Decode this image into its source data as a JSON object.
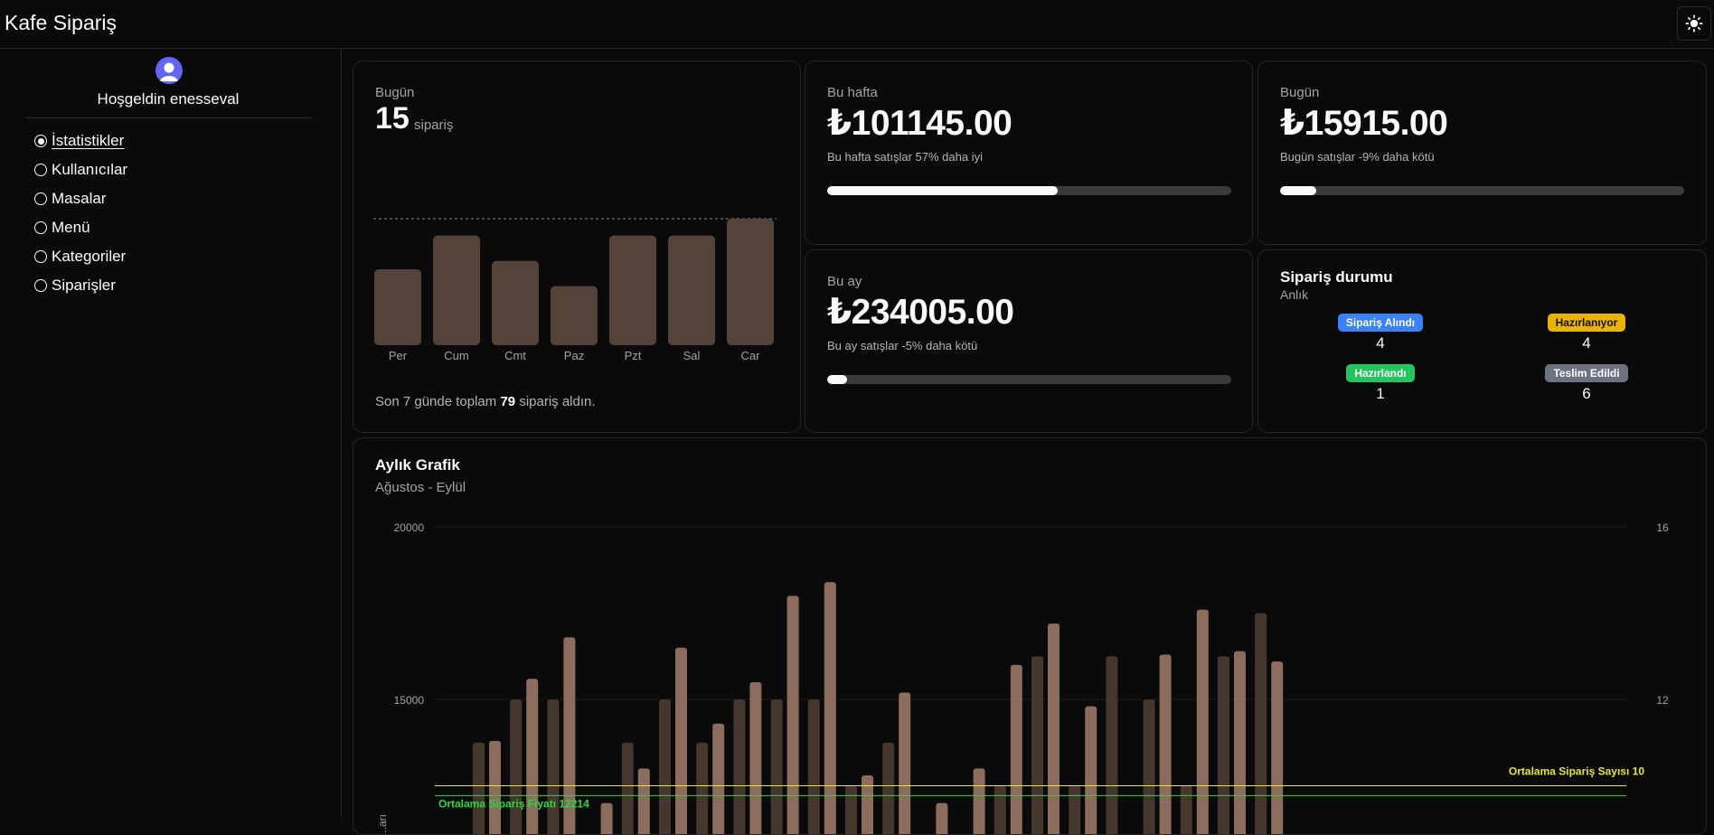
{
  "app": {
    "title": "Kafe Sipariş"
  },
  "theme_toggle": {
    "icon": "sun-icon"
  },
  "sidebar": {
    "welcome": "Hoşgeldin enesseval",
    "items": [
      {
        "label": "İstatistikler",
        "active": true
      },
      {
        "label": "Kullanıcılar",
        "active": false
      },
      {
        "label": "Masalar",
        "active": false
      },
      {
        "label": "Menü",
        "active": false
      },
      {
        "label": "Kategoriler",
        "active": false
      },
      {
        "label": "Siparişler",
        "active": false
      }
    ]
  },
  "today_orders": {
    "label": "Bugün",
    "count": "15",
    "unit": "sipariş",
    "summary_prefix": "Son 7 günde toplam",
    "summary_total": "79",
    "summary_suffix": "sipariş aldın."
  },
  "weekly": {
    "label": "Bu hafta",
    "amount": "₺101145.00",
    "sub": "Bu hafta satışlar 57% daha iyi",
    "progress": 0.57
  },
  "today_sales": {
    "label": "Bugün",
    "amount": "₺15915.00",
    "sub": "Bugün satışlar -9% daha kötü",
    "progress": 0.09
  },
  "monthly_sales": {
    "label": "Bu ay",
    "amount": "₺234005.00",
    "sub": "Bu ay satışlar -5% daha kötü",
    "progress": 0.05
  },
  "order_status": {
    "title": "Sipariş durumu",
    "subtitle": "Anlık",
    "items": [
      {
        "label": "Sipariş Alındı",
        "count": "4",
        "color": "#3b82f6"
      },
      {
        "label": "Hazırlanıyor",
        "count": "4",
        "color": "#eab308"
      },
      {
        "label": "Hazırlandı",
        "count": "1",
        "color": "#22c55e"
      },
      {
        "label": "Teslim Edildi",
        "count": "6",
        "color": "#6b7280"
      }
    ]
  },
  "colors": {
    "bar_brown": "#544338",
    "bar_dark": "#45362e",
    "bar_light": "#8c6c5c",
    "avg_count_line": "#e5e53a",
    "avg_price_line": "#2bd93f"
  },
  "chart_data": [
    {
      "type": "bar",
      "categories": [
        "Per",
        "Cum",
        "Cmt",
        "Paz",
        "Pzt",
        "Sal",
        "Çar"
      ],
      "values": [
        9,
        13,
        10,
        7,
        13,
        13,
        15
      ],
      "ylim": [
        0,
        15
      ]
    },
    {
      "type": "bar",
      "title": "Aylık Grafik",
      "subtitle": "Ağustos - Eylül",
      "left_axis": {
        "ticks": [
          "20000",
          "15000"
        ],
        "label": "...arı",
        "ylim": [
          6000,
          20000
        ]
      },
      "right_axis": {
        "ticks": [
          "16",
          "12"
        ],
        "ylim": [
          7,
          16
        ]
      },
      "series": [
        {
          "axis": "right",
          "values": [
            11,
            12,
            12,
            null,
            11,
            12,
            11,
            12,
            12,
            12,
            10,
            11,
            6,
            null,
            10,
            13,
            10,
            13,
            12,
            10,
            13,
            14
          ]
        },
        {
          "axis": "left",
          "values": [
            13800,
            15600,
            16800,
            12000,
            13000,
            16500,
            14300,
            15500,
            18000,
            18400,
            12800,
            15200,
            12000,
            13000,
            16000,
            17200,
            14800,
            9000,
            16300,
            17600,
            16400,
            16100
          ]
        }
      ],
      "annotations": [
        {
          "label": "Ortalama Sipariş Sayısı 10",
          "color": "#e5e53a",
          "value": 10
        },
        {
          "label": "Ortalama Sipariş Fiyatı 12214",
          "color": "#2bd93f",
          "value": 12214
        }
      ]
    }
  ]
}
